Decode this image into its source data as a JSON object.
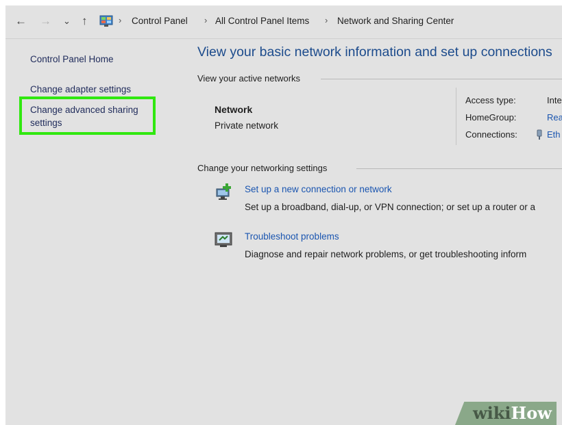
{
  "address_bar": {
    "back": "←",
    "forward": "→",
    "recent": "⌄",
    "up": "↑",
    "separator": "›",
    "breadcrumbs": [
      "Control Panel",
      "All Control Panel Items",
      "Network and Sharing Center"
    ]
  },
  "left_pane": {
    "home": "Control Panel Home",
    "adapter": "Change adapter settings",
    "advanced_line1": "Change advanced sharing",
    "advanced_line2": "settings"
  },
  "main": {
    "title": "View your basic network information and set up connections",
    "active_networks_label": "View your active networks",
    "network": {
      "name": "Network",
      "type": "Private network",
      "access_type_label": "Access type:",
      "access_type_value": "Inte",
      "homegroup_label": "HomeGroup:",
      "homegroup_value": "Rea",
      "connections_label": "Connections:",
      "connections_value": "Eth"
    },
    "settings_label": "Change your networking settings",
    "tasks": [
      {
        "icon": "new-connection-icon",
        "title": "Set up a new connection or network",
        "description": "Set up a broadband, dial-up, or VPN connection; or set up a router or a"
      },
      {
        "icon": "troubleshoot-icon",
        "title": "Troubleshoot problems",
        "description": "Diagnose and repair network problems, or get troubleshooting inform"
      }
    ]
  },
  "watermark": {
    "part1": "wiki",
    "part2": "How"
  },
  "colors": {
    "highlight": "#30e810",
    "link": "#1a55b0",
    "title": "#1c4b8c",
    "background": "#e2e2e2"
  }
}
